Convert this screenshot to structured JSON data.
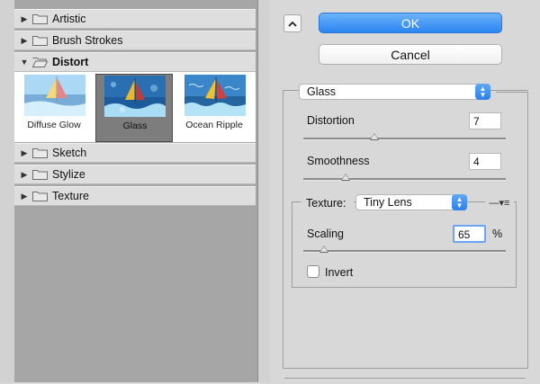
{
  "gallery": {
    "categories": [
      {
        "label": "Artistic",
        "expanded": false
      },
      {
        "label": "Brush Strokes",
        "expanded": false
      },
      {
        "label": "Distort",
        "expanded": true
      },
      {
        "label": "Sketch",
        "expanded": false
      },
      {
        "label": "Stylize",
        "expanded": false
      },
      {
        "label": "Texture",
        "expanded": false
      }
    ],
    "thumbnails": [
      {
        "label": "Diffuse Glow",
        "selected": false
      },
      {
        "label": "Glass",
        "selected": true
      },
      {
        "label": "Ocean Ripple",
        "selected": false
      }
    ]
  },
  "buttons": {
    "ok": "OK",
    "cancel": "Cancel"
  },
  "filter": {
    "selected": "Glass",
    "distortion": {
      "label": "Distortion",
      "value": "7",
      "fraction": 0.35
    },
    "smoothness": {
      "label": "Smoothness",
      "value": "4",
      "fraction": 0.21
    },
    "texture": {
      "label": "Texture:",
      "value": "Tiny Lens"
    },
    "scaling": {
      "label": "Scaling",
      "value": "65",
      "unit": "%",
      "fraction": 0.1
    },
    "invert": {
      "label": "Invert",
      "checked": false
    }
  },
  "colors": {
    "accent": "#2a84f2",
    "field_focus": "#6aa5f3"
  }
}
